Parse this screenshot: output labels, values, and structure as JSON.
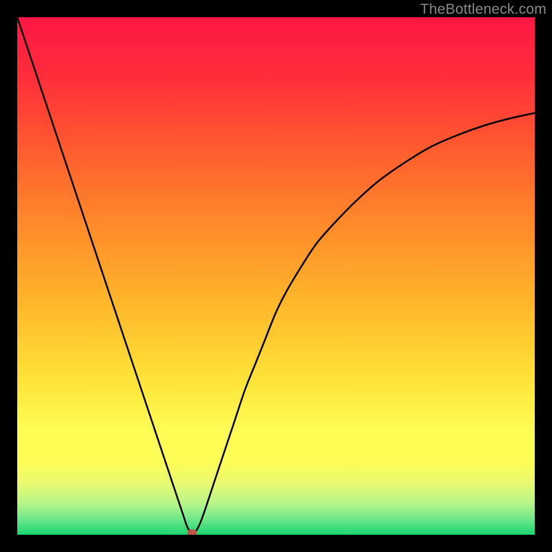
{
  "watermark": "TheBottleneck.com",
  "chart_data": {
    "type": "line",
    "title": "",
    "xlabel": "",
    "ylabel": "",
    "xlim": [
      0,
      100
    ],
    "ylim": [
      0,
      100
    ],
    "grid": false,
    "background_gradient": {
      "stops": [
        {
          "pos": 0.0,
          "color": "#ff1744"
        },
        {
          "pos": 0.12,
          "color": "#ff2f3a"
        },
        {
          "pos": 0.25,
          "color": "#ff5a2f"
        },
        {
          "pos": 0.4,
          "color": "#ff8a2a"
        },
        {
          "pos": 0.55,
          "color": "#ffb62a"
        },
        {
          "pos": 0.7,
          "color": "#ffe338"
        },
        {
          "pos": 0.8,
          "color": "#fdfd55"
        },
        {
          "pos": 0.86,
          "color": "#fdfd55"
        },
        {
          "pos": 0.9,
          "color": "#e9fa70"
        },
        {
          "pos": 0.94,
          "color": "#b6f58a"
        },
        {
          "pos": 0.97,
          "color": "#6de88a"
        },
        {
          "pos": 1.0,
          "color": "#18d66f"
        }
      ]
    },
    "series": [
      {
        "name": "bottleneck-curve",
        "color": "#000000",
        "x": [
          0,
          2,
          4,
          6,
          8,
          10,
          12,
          14,
          16,
          18,
          20,
          22,
          24,
          26,
          28,
          30,
          32,
          33,
          34,
          35,
          36,
          38,
          40,
          42,
          44,
          46,
          48,
          50,
          52,
          55,
          58,
          62,
          66,
          70,
          75,
          80,
          85,
          90,
          95,
          100
        ],
        "y": [
          100,
          94,
          88,
          82,
          76,
          70,
          64,
          58,
          52,
          46,
          40,
          34,
          28,
          22,
          16,
          10,
          4,
          1.2,
          0.3,
          1.5,
          4,
          10,
          16,
          22,
          28,
          33,
          38,
          43,
          47,
          52,
          56.5,
          61,
          65,
          68.5,
          72,
          75,
          77.2,
          79,
          80.4,
          81.5
        ]
      }
    ],
    "marker": {
      "name": "valley-marker",
      "x": 33.8,
      "y": 0,
      "color": "#c0564a",
      "rx": 7,
      "ry": 5
    }
  }
}
